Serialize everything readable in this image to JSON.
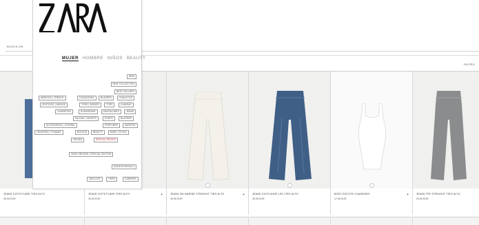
{
  "search": {
    "placeholder": "BUSCA UN"
  },
  "filter": {
    "label": "FILTRO"
  },
  "products": [
    {
      "name": "JEANS Z1975 FLARE TIRO ALTO",
      "colors": "■+2",
      "price": "39,95 EUR"
    },
    {
      "name": "JEANS Z1975 FLARE TIRO ALTO",
      "colors": "■+1",
      "price": "39,95 EUR"
    },
    {
      "name": "JEANS ZW MARINE STRAIGHT TIRO ALTO",
      "colors": "",
      "price": "39,95 EUR"
    },
    {
      "name": "JEANS Z1975 WIDE LEG TIRO ALTO",
      "colors": "■+2",
      "price": "39,95 EUR"
    },
    {
      "name": "BODY ESCOTE CUADRADO",
      "colors": "■+1",
      "price": "17,95 EUR"
    },
    {
      "name": "JEANS TRF STRAIGHT TIRO ALTO",
      "colors": "■+1",
      "price": "29,95 EUR"
    }
  ],
  "plus": "+",
  "menu": {
    "tabs": [
      "MUJER",
      "HOMBRE",
      "NIÑOS",
      "BEAUTY"
    ],
    "rows": [
      [
        "NEW"
      ],
      [
        "NEW COLLECTION"
      ],
      [
        "BEST SELLERS"
      ],
      [
        "ABRIGOS | TRENCH",
        "CAZADORAS",
        "BLAZERS",
        "CHALECOS"
      ],
      [
        "VESTIDOS | MONOS",
        "TOPS | BODIES",
        "TOPS",
        "CAMISAS"
      ],
      [
        "CAMISETAS",
        "SUDADERAS",
        "PANTALONES",
        "JEANS"
      ],
      [
        "FALDAS | SHORTS",
        "PUNTO",
        "BLAZERS"
      ],
      [
        "ACCESORIOS | JOYERÍA",
        "PERFUMES",
        "ZAPATOS"
      ],
      [
        "LENCERÍA | PIJAMAS",
        "BOLSOS",
        "BEAUTY",
        "BAÑO | PLAYA"
      ],
      [
        "TRAJES",
        "SPECIAL PRICES"
      ],
      [
        "ZARA ORIGINS | SPECIAL EDITION"
      ],
      [
        "TARJETA REGALO"
      ],
      [
        "JOIN LIFE",
        "+INFO",
        "CAREERS"
      ]
    ]
  },
  "colors": {
    "accent": "#111111",
    "sale": "#cc2233"
  }
}
